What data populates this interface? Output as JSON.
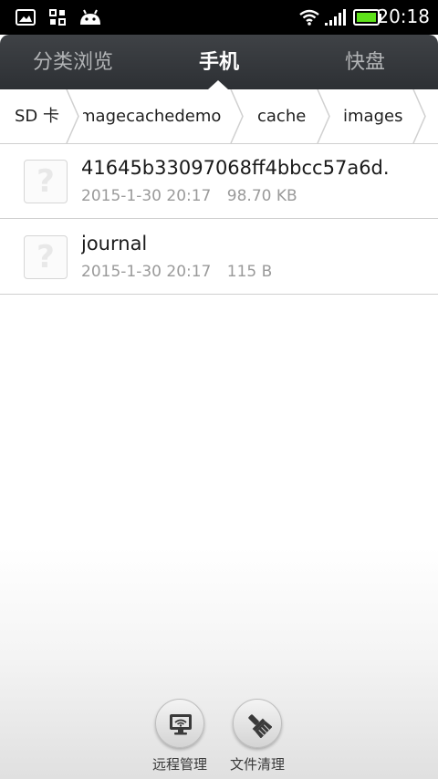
{
  "status_bar": {
    "time": "20:18",
    "icons": [
      "gallery-icon",
      "apps-icon",
      "android-icon",
      "wifi-icon",
      "signal-icon",
      "battery-icon"
    ],
    "battery_color": "#5ee21a"
  },
  "tabs": [
    {
      "label": "分类浏览",
      "active": false
    },
    {
      "label": "手机",
      "active": true
    },
    {
      "label": "快盘",
      "active": false
    }
  ],
  "breadcrumb": [
    "SD 卡",
    "imagecachedemo",
    "cache",
    "images"
  ],
  "files": [
    {
      "name": "41645b33097068ff4bbcc57a6d.",
      "date": "2015-1-30 20:17",
      "size": "98.70 KB",
      "icon": "unknown-file-icon"
    },
    {
      "name": "journal",
      "date": "2015-1-30 20:17",
      "size": "115 B",
      "icon": "unknown-file-icon"
    }
  ],
  "actions": [
    {
      "label": "远程管理",
      "icon": "remote-monitor-icon"
    },
    {
      "label": "文件清理",
      "icon": "brush-clean-icon"
    }
  ]
}
